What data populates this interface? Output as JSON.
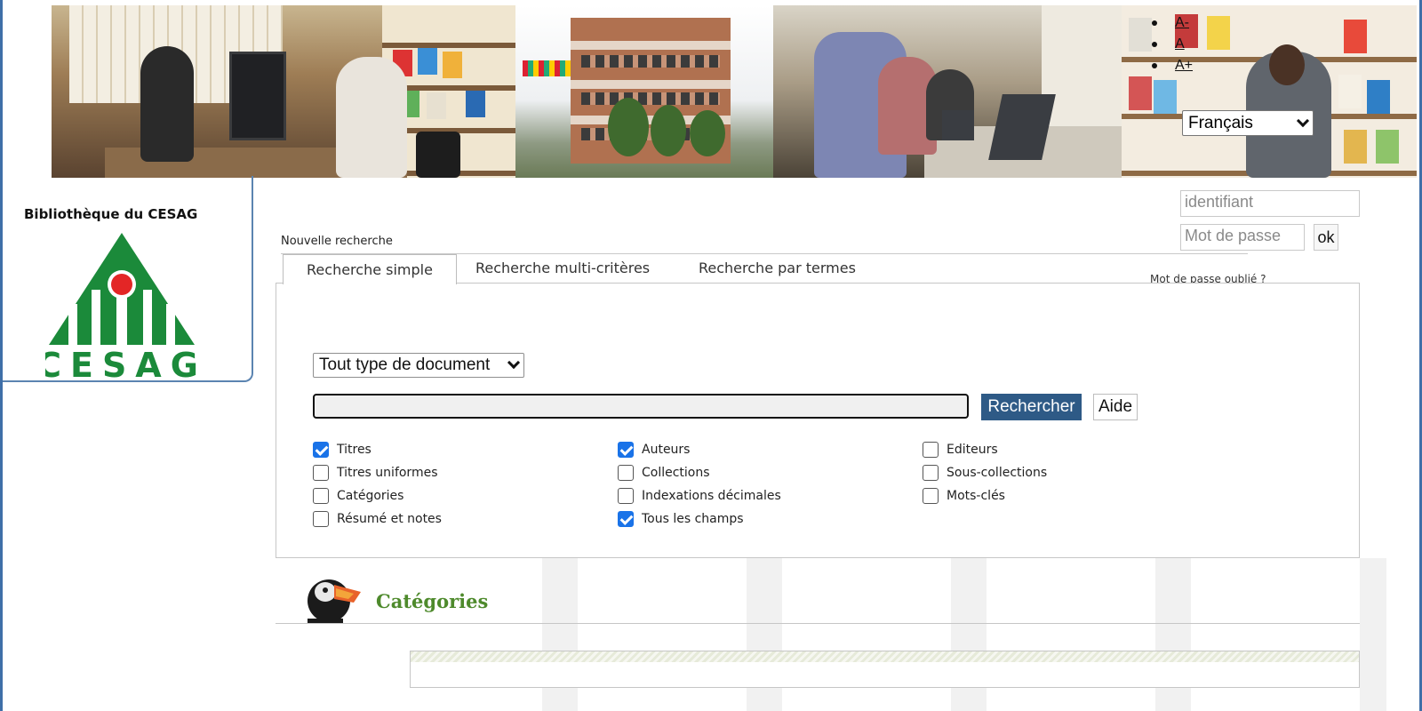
{
  "header": {
    "font_size_controls": [
      "A-",
      "A",
      "A+"
    ],
    "language": {
      "selected": "Français"
    }
  },
  "library": {
    "name": "Bibliothèque du CESAG",
    "logo_text": "CESAG",
    "logo_colors": {
      "green": "#1b8a3a",
      "red": "#e32626"
    }
  },
  "login": {
    "username_placeholder": "identifiant",
    "password_placeholder": "Mot de passe",
    "submit_label": "ok",
    "forgot_label": "Mot de passe oublié ?"
  },
  "search": {
    "new_search_label": "Nouvelle recherche",
    "tabs": [
      {
        "label": "Recherche simple",
        "active": true
      },
      {
        "label": "Recherche multi-critères",
        "active": false
      },
      {
        "label": "Recherche par termes",
        "active": false
      }
    ],
    "doc_type": {
      "selected": "Tout type de document"
    },
    "query": {
      "value": ""
    },
    "submit_label": "Rechercher",
    "help_label": "Aide",
    "accent_color": "#2e5a86",
    "fields": [
      {
        "label": "Titres",
        "checked": true
      },
      {
        "label": "Titres uniformes",
        "checked": false
      },
      {
        "label": "Catégories",
        "checked": false
      },
      {
        "label": "Résumé et notes",
        "checked": false
      },
      {
        "label": "Auteurs",
        "checked": true
      },
      {
        "label": "Collections",
        "checked": false
      },
      {
        "label": "Indexations décimales",
        "checked": false
      },
      {
        "label": "Tous les champs",
        "checked": true
      },
      {
        "label": "Editeurs",
        "checked": false
      },
      {
        "label": "Sous-collections",
        "checked": false
      },
      {
        "label": "Mots-clés",
        "checked": false
      }
    ]
  },
  "categories": {
    "title": "Catégories",
    "title_color": "#4e8a2c"
  }
}
